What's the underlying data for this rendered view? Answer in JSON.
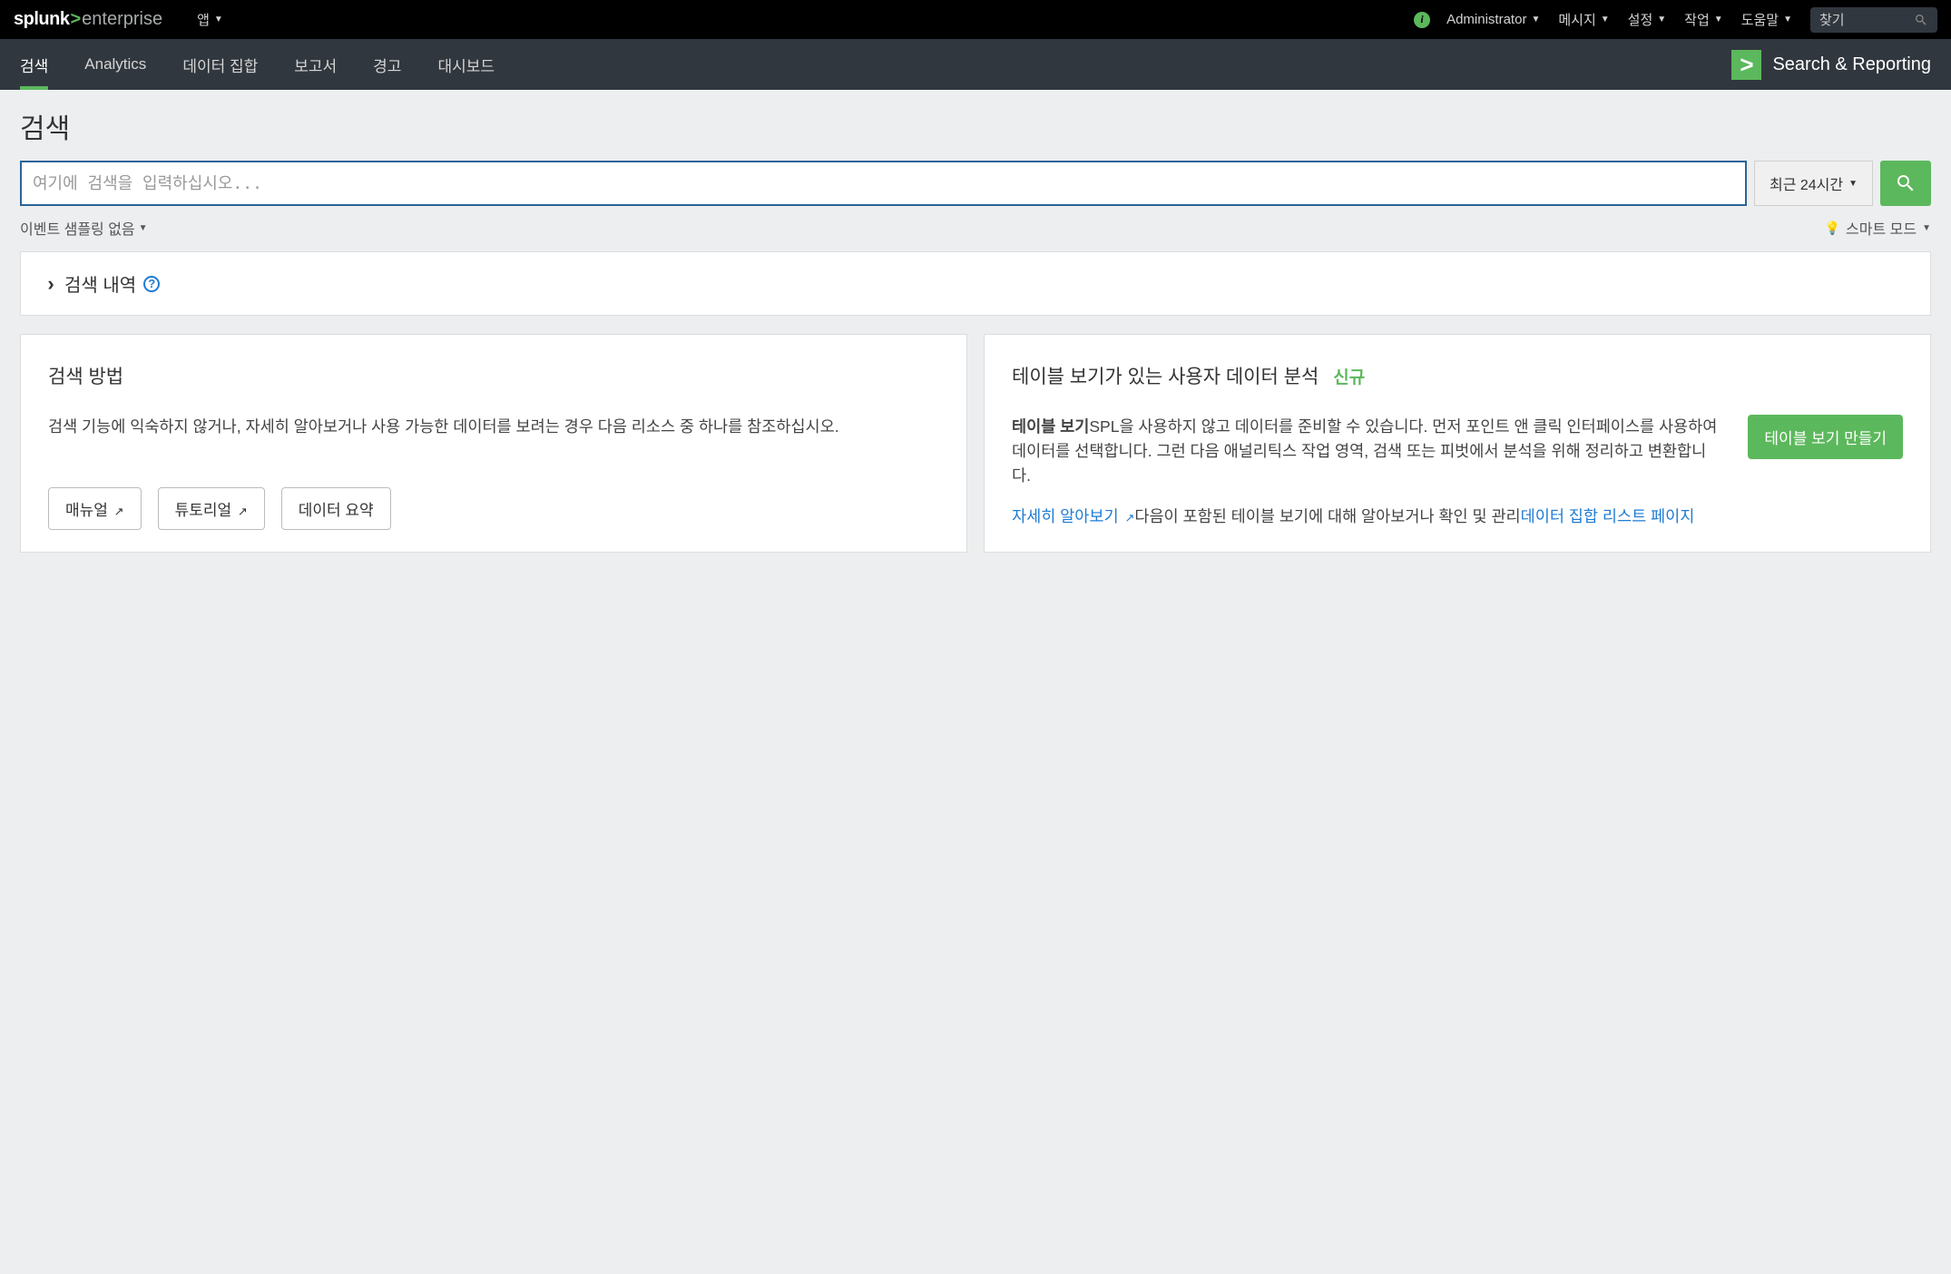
{
  "topbar": {
    "logo_splunk": "splunk",
    "logo_arrow": ">",
    "logo_enterprise": "enterprise",
    "app_menu": "앱",
    "administrator": "Administrator",
    "messages": "메시지",
    "settings": "설정",
    "tasks": "작업",
    "help": "도움말",
    "find_placeholder": "찾기"
  },
  "appnav": {
    "search": "검색",
    "analytics": "Analytics",
    "datasets": "데이터 집합",
    "reports": "보고서",
    "alerts": "경고",
    "dashboards": "대시보드",
    "app_title": "Search & Reporting"
  },
  "page": {
    "title": "검색",
    "search_placeholder": "여기에 검색을 입력하십시오...",
    "time_range": "최근 24시간",
    "sampling": "이벤트 샘플링 없음",
    "smart_mode": "스마트 모드",
    "history_title": "검색 내역"
  },
  "card_left": {
    "title": "검색 방법",
    "body": "검색 기능에 익숙하지 않거나, 자세히 알아보거나 사용 가능한 데이터를 보려는 경우 다음 리소스 중 하나를 참조하십시오.",
    "btn_manual": "매뉴얼",
    "btn_tutorial": "튜토리얼",
    "btn_summary": "데이터 요약"
  },
  "card_right": {
    "title": "테이블 보기가 있는 사용자 데이터 분석",
    "badge_new": "신규",
    "body_bold": "테이블 보기",
    "body_rest": "SPL을 사용하지 않고 데이터를 준비할 수 있습니다. 먼저 포인트 앤 클릭 인터페이스를 사용하여 데이터를 선택합니다. 그런 다음 애널리틱스 작업 영역, 검색 또는 피벗에서 분석을 위해 정리하고 변환합니다.",
    "learn_more": "자세히 알아보기",
    "body_tail": "다음이 포함된 테이블 보기에 대해 알아보거나 확인 및 관리",
    "datasets_link": "데이터 집합 리스트 페이지",
    "btn_create": "테이블 보기 만들기"
  }
}
